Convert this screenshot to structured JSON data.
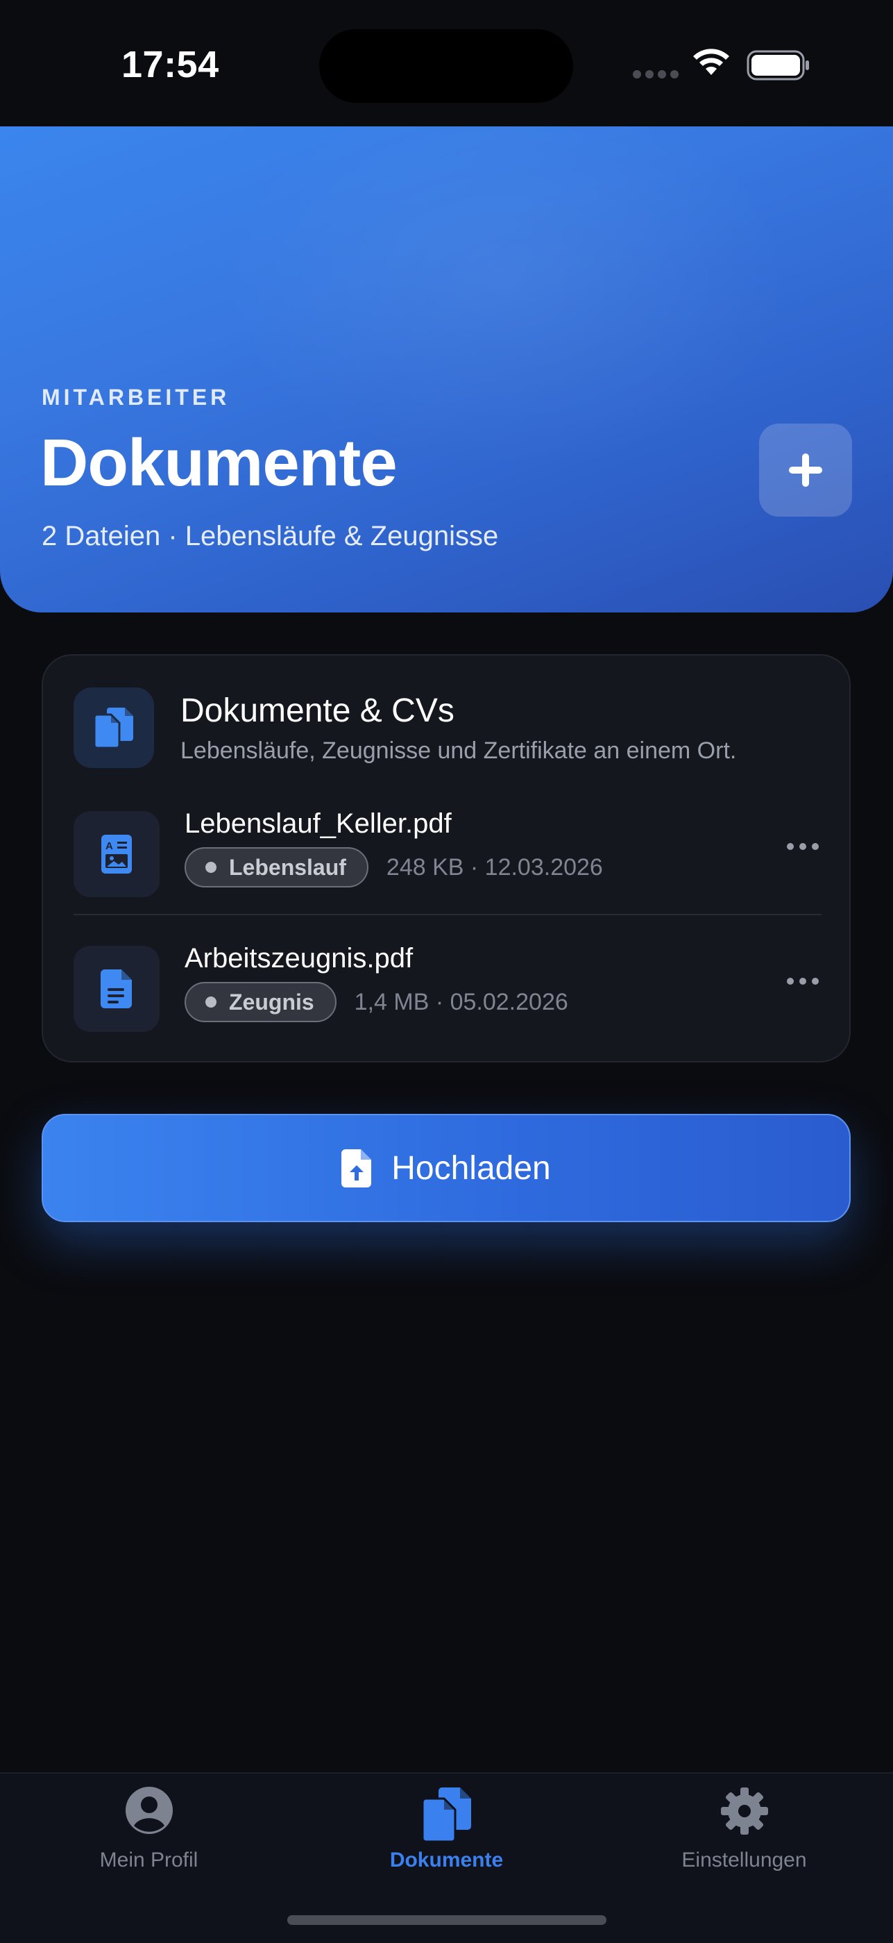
{
  "status": {
    "time": "17:54"
  },
  "hero": {
    "eyebrow": "MITARBEITER",
    "title": "Dokumente",
    "subtitle": "2 Dateien · Lebensläufe & Zeugnisse",
    "add_icon": "plus-icon"
  },
  "card": {
    "title": "Dokumente & CVs",
    "subtitle": "Lebensläufe, Zeugnisse und Zertifikate an einem Ort.",
    "icon": "documents-icon",
    "files": [
      {
        "name": "Lebenslauf_Keller.pdf",
        "tag": "Lebenslauf",
        "meta": "248 KB · 12.03.2026",
        "icon": "resume-icon"
      },
      {
        "name": "Arbeitszeugnis.pdf",
        "tag": "Zeugnis",
        "meta": "1,4 MB · 05.02.2026",
        "icon": "document-text-icon"
      }
    ]
  },
  "upload_button": {
    "label": "Hochladen",
    "icon": "file-upload-icon"
  },
  "tabs": [
    {
      "label": "Mein Profil",
      "icon": "person-circle-icon",
      "active": false
    },
    {
      "label": "Dokumente",
      "icon": "documents-icon",
      "active": true
    },
    {
      "label": "Einstellungen",
      "icon": "gear-icon",
      "active": false
    }
  ],
  "colors": {
    "accent": "#3a80ee",
    "background": "#0b0c10",
    "card": "#14171e",
    "hero_start": "#3a86ee",
    "hero_end": "#2a4fb2"
  }
}
